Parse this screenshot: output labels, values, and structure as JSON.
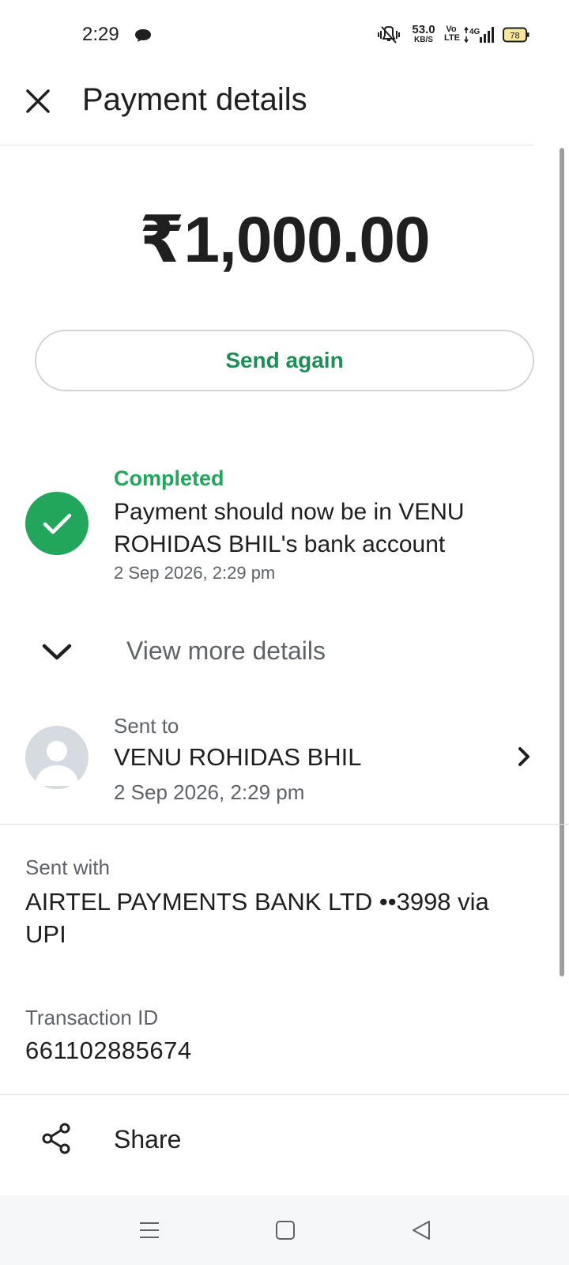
{
  "status_bar": {
    "time": "2:29",
    "net_speed_value": "53.0",
    "net_speed_unit": "KB/S",
    "volte_top": "Vo",
    "volte_bottom": "LTE",
    "network_type": "4G",
    "battery_level": "78",
    "icons": [
      "chat-bubble-icon",
      "mute-icon",
      "signal-icon",
      "battery-icon"
    ]
  },
  "header": {
    "title": "Payment details",
    "close_icon": "close-icon"
  },
  "payment": {
    "amount": "₹1,000.00",
    "send_again_label": "Send again"
  },
  "status": {
    "label": "Completed",
    "message": "Payment should now be in VENU ROHIDAS BHIL's bank account",
    "timestamp": "2 Sep 2026, 2:29 pm",
    "icon": "check-icon",
    "color": "#21a65b"
  },
  "view_more": {
    "label": "View more details",
    "icon": "chevron-down-icon"
  },
  "sent_to": {
    "label": "Sent to",
    "name": "VENU ROHIDAS BHIL",
    "timestamp": "2 Sep 2026, 2:29 pm",
    "icon": "chevron-right-icon"
  },
  "sent_with": {
    "label": "Sent with",
    "value": "AIRTEL PAYMENTS BANK LTD ••3998 via UPI"
  },
  "transaction": {
    "label": "Transaction ID",
    "value": "661102885674"
  },
  "share": {
    "label": "Share",
    "icon": "share-icon"
  },
  "nav_bar": {
    "icons": [
      "menu-icon",
      "home-icon",
      "back-icon"
    ]
  },
  "colors": {
    "accent_green": "#1e8e57",
    "success_green": "#21a65b",
    "text_primary": "#1f1f1f",
    "text_secondary": "#5f6368"
  }
}
